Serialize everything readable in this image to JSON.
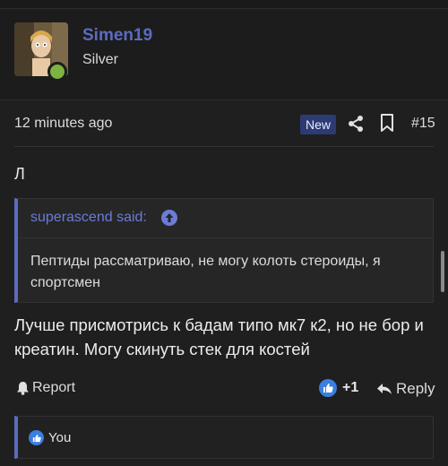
{
  "user": {
    "name": "Simen19",
    "rank": "Silver"
  },
  "meta": {
    "timestamp": "12 minutes ago",
    "new_badge": "New",
    "post_number": "#15"
  },
  "post": {
    "short_line": "Л",
    "quote": {
      "author_said": "superascend said:",
      "body": "Пептиды рассматриваю, не могу колоть стероиды, я спортсмен"
    },
    "message": "Лучше присмотрись к бадам типо мк7 к2, но не бор и креатин. Могу скинуть стек для костей"
  },
  "actions": {
    "report_label": "Report",
    "reaction_count": "+1",
    "reply_label": "Reply"
  },
  "reactions_bar": {
    "label": "You"
  },
  "colors": {
    "accent": "#5c6bc0",
    "online": "#7cb342",
    "like": "#3b7fe0",
    "new_badge_bg": "#2c3b73"
  },
  "icons": [
    "share-icon",
    "bookmark-icon",
    "arrow-up-icon",
    "bell-icon",
    "like-icon",
    "reply-arrow-icon"
  ]
}
